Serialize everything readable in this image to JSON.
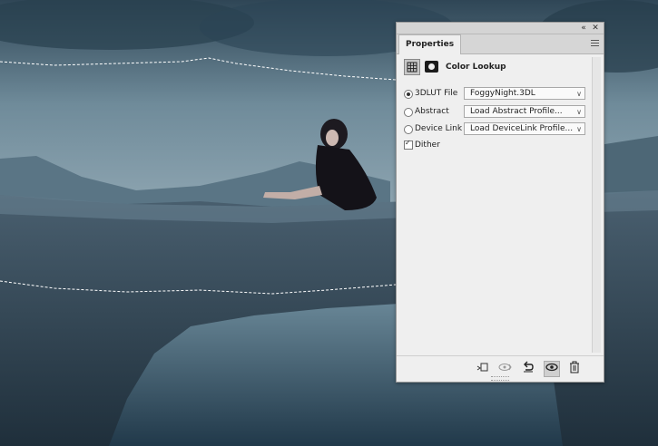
{
  "panel": {
    "collapse_icon": "«",
    "close_icon": "✕",
    "tab_label": "Properties",
    "header_title": "Color Lookup",
    "options": [
      {
        "label": "3DLUT File",
        "value": "FoggyNight.3DL",
        "selected": true
      },
      {
        "label": "Abstract",
        "value": "Load Abstract Profile...",
        "selected": false
      },
      {
        "label": "Device Link",
        "value": "Load DeviceLink Profile...",
        "selected": false
      }
    ],
    "dither_label": "Dither",
    "dither_checked": true,
    "footer_icons": [
      "clip-to-layer-icon",
      "view-previous-state-icon",
      "reset-icon",
      "visibility-eye-icon",
      "trash-icon"
    ]
  }
}
